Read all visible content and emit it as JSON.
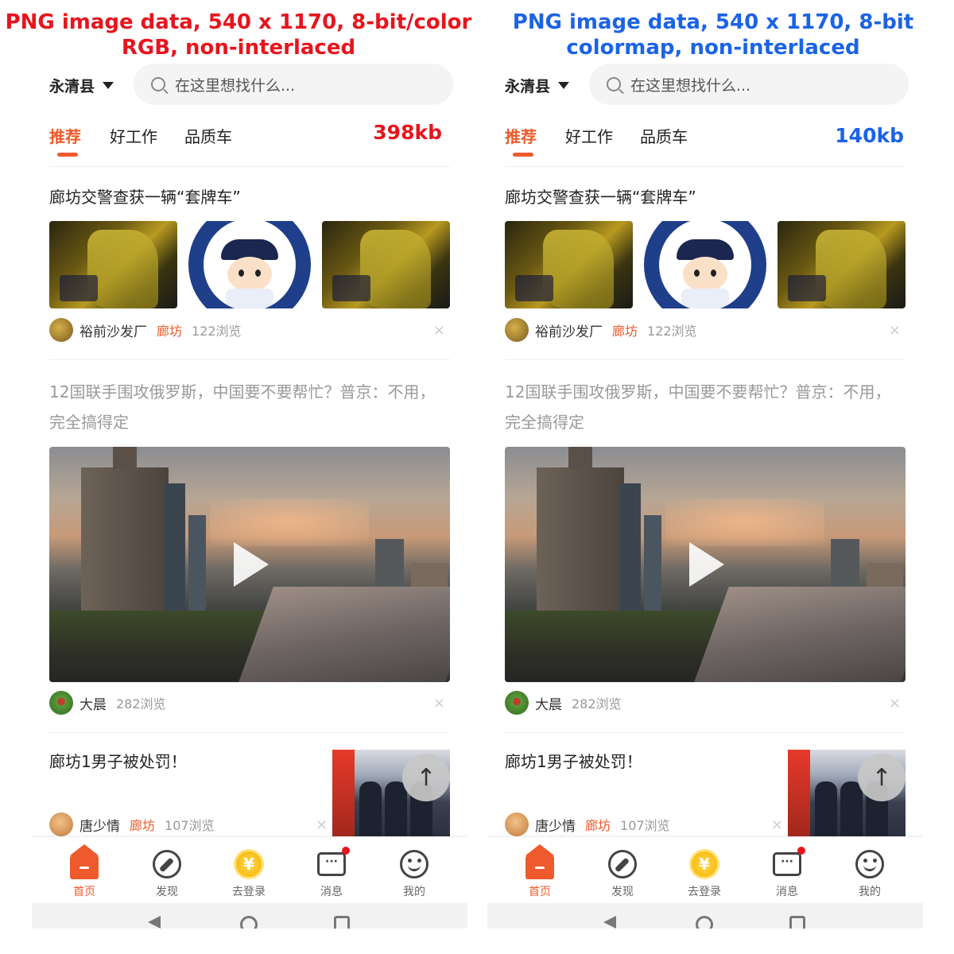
{
  "captions": {
    "left": "PNG image data, 540 x 1170, 8-bit/color RGB, non-interlaced",
    "right": "PNG image data, 540 x 1170, 8-bit colormap, non-interlaced"
  },
  "size_labels": {
    "left": "398kb",
    "right": "140kb"
  },
  "header": {
    "city": "永清县",
    "search_placeholder": "在这里想找什么..."
  },
  "tabs": [
    "推荐",
    "好工作",
    "品质车"
  ],
  "feed": {
    "item1": {
      "title": "廊坊交警查获一辆“套牌车”",
      "author": "裕前沙发厂",
      "tag": "廊坊",
      "views": "122浏览"
    },
    "item2": {
      "title": "12国联手围攻俄罗斯，中国要不要帮忙？普京：不用，完全搞得定",
      "author": "大晨",
      "views": "282浏览"
    },
    "item3": {
      "title": "廊坊1男子被处罚！",
      "author": "唐少情",
      "tag": "廊坊",
      "views": "107浏览"
    }
  },
  "close_glyph": "×",
  "back_to_top_glyph": "↑",
  "nav": {
    "home": "首页",
    "discover": "发现",
    "login": "去登录",
    "messages": "消息",
    "mine": "我的",
    "coin_glyph": "¥",
    "msg_glyph": "···"
  },
  "colors": {
    "accent": "#ef5a2c",
    "left_caption": "#e8141c",
    "right_caption": "#1b63e6"
  }
}
